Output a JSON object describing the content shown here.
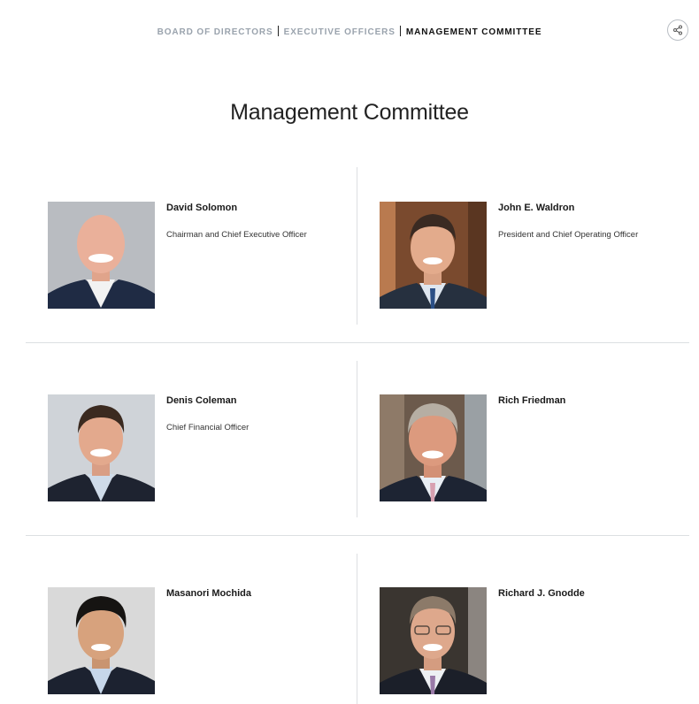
{
  "nav": {
    "items": [
      {
        "label": "BOARD OF DIRECTORS",
        "active": false
      },
      {
        "label": "EXECUTIVE OFFICERS",
        "active": false
      },
      {
        "label": "MANAGEMENT COMMITTEE",
        "active": true
      }
    ]
  },
  "share": {
    "icon": "share-icon"
  },
  "page_title": "Management Committee",
  "members": [
    {
      "name": "David Solomon",
      "title": "Chairman and Chief Executive Officer",
      "photo_bg": "#b9bcc1"
    },
    {
      "name": "John E. Waldron",
      "title": "President and Chief Operating Officer",
      "photo_bg": "#7a4a2e"
    },
    {
      "name": "Denis Coleman",
      "title": "Chief Financial Officer",
      "photo_bg": "#cfd3d8"
    },
    {
      "name": "Rich Friedman",
      "title": "",
      "photo_bg": "#6c5a4c"
    },
    {
      "name": "Masanori Mochida",
      "title": "",
      "photo_bg": "#d9d9d9"
    },
    {
      "name": "Richard J. Gnodde",
      "title": "",
      "photo_bg": "#3a3530"
    }
  ]
}
